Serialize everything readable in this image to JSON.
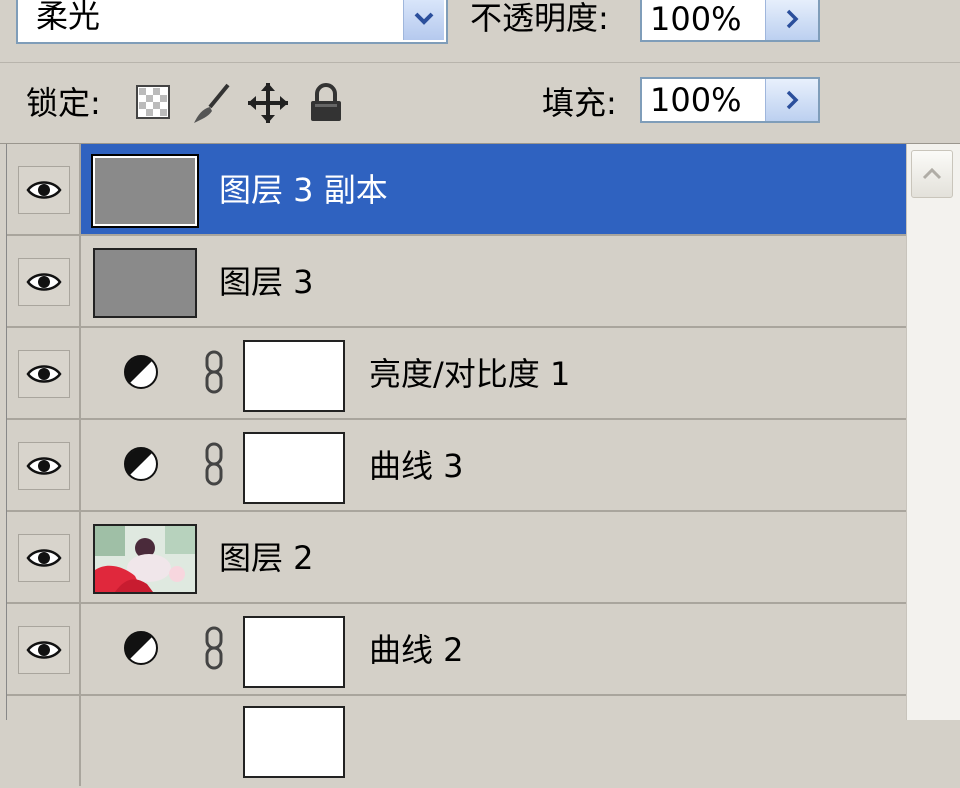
{
  "options": {
    "blend_mode": "柔光",
    "opacity_label": "不透明度:",
    "opacity_value": "100%",
    "lock_label": "锁定:",
    "fill_label": "填充:",
    "fill_value": "100%"
  },
  "layers": [
    {
      "name": "图层 3 副本",
      "kind": "pixel",
      "selected": true
    },
    {
      "name": "图层 3",
      "kind": "pixel",
      "selected": false
    },
    {
      "name": "亮度/对比度 1",
      "kind": "adjustment",
      "selected": false
    },
    {
      "name": "曲线 3",
      "kind": "adjustment",
      "selected": false
    },
    {
      "name": "图层 2",
      "kind": "photo",
      "selected": false
    },
    {
      "name": "曲线 2",
      "kind": "adjustment",
      "selected": false
    }
  ],
  "colors": {
    "panel_bg": "#d4d0c8",
    "selection": "#2f62c0",
    "field_border": "#7f9db9"
  }
}
